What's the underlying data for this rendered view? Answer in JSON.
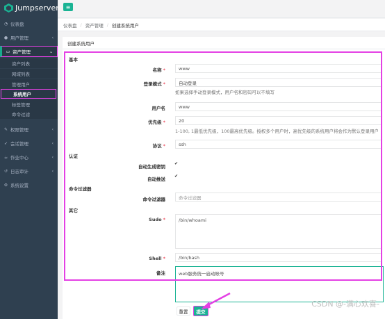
{
  "app": {
    "name": "Jumpserver"
  },
  "nav": {
    "dashboard": "仪表盘",
    "users": "用户管理",
    "assets": "资产管理",
    "asset_list": "资产列表",
    "domain_list": "网域列表",
    "admin_user": "管理用户",
    "system_user": "系统用户",
    "label_mgmt": "标签管理",
    "cmd_filter": "命令过滤",
    "perms": "权限管理",
    "sessions": "会话管理",
    "jobs": "作业中心",
    "audits": "日志审计",
    "settings": "系统设置"
  },
  "breadcrumb": [
    "仪表盘",
    "资产管理",
    "创建系统用户"
  ],
  "panel": {
    "title": "创建系统用户"
  },
  "form": {
    "section_basic": "基本",
    "name_label": "名称",
    "name_value": "www",
    "login_mode_label": "登录模式",
    "login_mode_value": "自动登录",
    "login_mode_help": "如果选择手动登录模式，用户名和密码可以不填写",
    "username_label": "用户名",
    "username_value": "www",
    "priority_label": "优先级",
    "priority_value": "20",
    "priority_help": "1-100, 1最低优先级，100最高优先级。授权多个用户时，高优先级的系统用户将会作为默认登录用户",
    "protocol_label": "协议",
    "protocol_value": "ssh",
    "section_auth": "认证",
    "auto_generate_label": "自动生成密钥",
    "auto_push_label": "自动推送",
    "section_cmd": "命令过滤器",
    "cmd_filter_label": "命令过滤器",
    "cmd_filter_placeholder": "命令过滤器",
    "section_other": "其它",
    "sudo_label": "Sudo",
    "sudo_value": "/bin/whoami",
    "shell_label": "Shell",
    "shell_value": "/bin/bash",
    "comment_label": "备注",
    "comment_value": "web服务统一启动帐号",
    "reset_label": "重置",
    "submit_label": "提交"
  },
  "watermark": "CSDN @-满心欢喜-",
  "colors": {
    "sidebar": "#2f4050",
    "accent": "#1ab394",
    "highlight": "#e440e4"
  },
  "icons": {
    "dashboard": "dashboard-icon",
    "users": "users-icon",
    "assets": "inbox-icon"
  }
}
